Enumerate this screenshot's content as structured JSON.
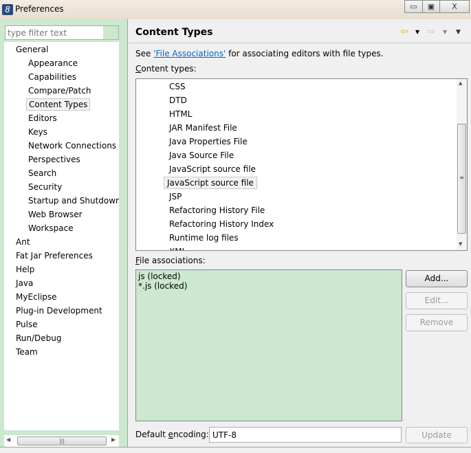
{
  "window": {
    "title": "Preferences",
    "minimize": "▭",
    "maximize": "▣",
    "close": "X"
  },
  "filter": {
    "placeholder": "type filter text"
  },
  "tree": [
    {
      "label": "General",
      "level": 0
    },
    {
      "label": "Appearance",
      "level": 1
    },
    {
      "label": "Capabilities",
      "level": 1
    },
    {
      "label": "Compare/Patch",
      "level": 1
    },
    {
      "label": "Content Types",
      "level": 1,
      "selected": true
    },
    {
      "label": "Editors",
      "level": 1
    },
    {
      "label": "Keys",
      "level": 1
    },
    {
      "label": "Network Connections",
      "level": 1
    },
    {
      "label": "Perspectives",
      "level": 1
    },
    {
      "label": "Search",
      "level": 1
    },
    {
      "label": "Security",
      "level": 1
    },
    {
      "label": "Startup and Shutdown",
      "level": 1
    },
    {
      "label": "Web Browser",
      "level": 1
    },
    {
      "label": "Workspace",
      "level": 1
    },
    {
      "label": "Ant",
      "level": 0
    },
    {
      "label": "Fat Jar Preferences",
      "level": 0
    },
    {
      "label": "Help",
      "level": 0
    },
    {
      "label": "Java",
      "level": 0
    },
    {
      "label": "MyEclipse",
      "level": 0
    },
    {
      "label": "Plug-in Development",
      "level": 0
    },
    {
      "label": "Pulse",
      "level": 0
    },
    {
      "label": "Run/Debug",
      "level": 0
    },
    {
      "label": "Team",
      "level": 0
    }
  ],
  "page": {
    "title": "Content Types",
    "see_prefix": "See ",
    "link": "'File Associations'",
    "see_suffix": " for associating editors with file types.",
    "content_types_key": "C",
    "content_types_rest": "ontent types:",
    "content_types": [
      "CSS",
      "DTD",
      "HTML",
      "JAR Manifest File",
      "Java Properties File",
      "Java Source File",
      "JavaScript source file",
      "JavaScript source file",
      "JSP",
      "Refactoring History File",
      "Refactoring History Index",
      "Runtime log files",
      "XML"
    ],
    "selected_index": 7,
    "file_assoc_key": "F",
    "file_assoc_rest": "ile associations:",
    "file_associations": [
      "js (locked)",
      "*.js (locked)"
    ],
    "buttons": {
      "add": "Add...",
      "edit": "Edit...",
      "remove": "Remove",
      "update": "Update"
    },
    "encoding_label_a": "Default ",
    "encoding_label_key": "e",
    "encoding_label_b": "ncoding:",
    "encoding_value": "UTF-8"
  },
  "colors": {
    "panel_green": "#cce8cf",
    "link": "#0066cc",
    "back_arrow": "#e8b830"
  }
}
